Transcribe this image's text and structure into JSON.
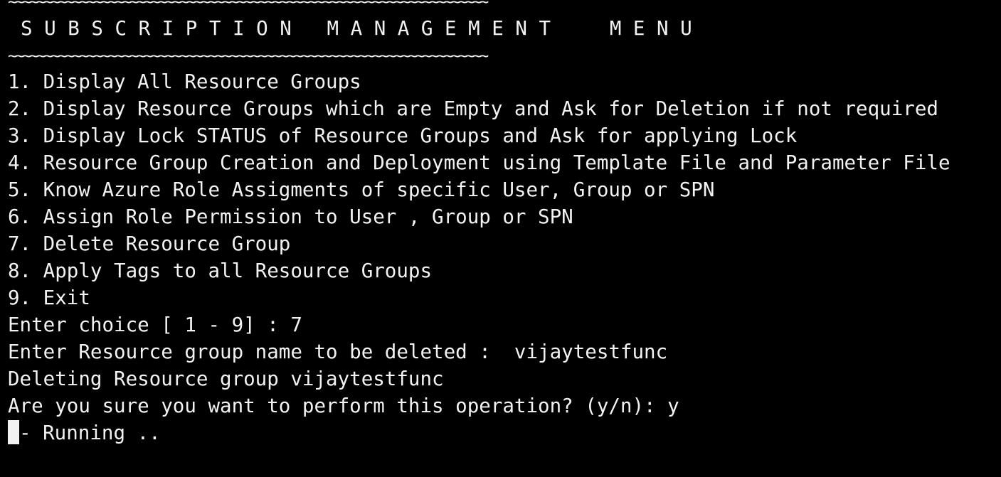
{
  "terminal": {
    "tilde_rule_top": "~~~~~~~~~~~~~~~~~~~~~~~~~~~~~~~~~~~~~~~~~~~~~~~~~~~~~~~~~~~~~~~~~~~",
    "title": "S U B S C R I P T I O N   M A N A G E M E N T     M E N U",
    "tilde_rule_bottom": "~~~~~~~~~~~~~~~~~~~~~~~~~~~~~~~~~~~~~~~~~~~~~~~~~~~~~~~~~~~~~~~~~~~",
    "menu_items": [
      "1. Display All Resource Groups",
      "2. Display Resource Groups which are Empty and Ask for Deletion if not required",
      "3. Display Lock STATUS of Resource Groups and Ask for applying Lock",
      "4. Resource Group Creation and Deployment using Template File and Parameter File",
      "5. Know Azure Role Assigments of specific User, Group or SPN",
      "6. Assign Role Permission to User , Group or SPN",
      "7. Delete Resource Group",
      "8. Apply Tags to all Resource Groups",
      "9. Exit"
    ],
    "output_lines": [
      "Enter choice [ 1 - 9] : 7",
      "Enter Resource group name to be deleted :  vijaytestfunc",
      "Deleting Resource group vijaytestfunc",
      "Are you sure you want to perform this operation? (y/n): y"
    ],
    "status_line": "- Running ..",
    "colors": {
      "background": "#000000",
      "foreground": "#f2f2f2"
    }
  }
}
